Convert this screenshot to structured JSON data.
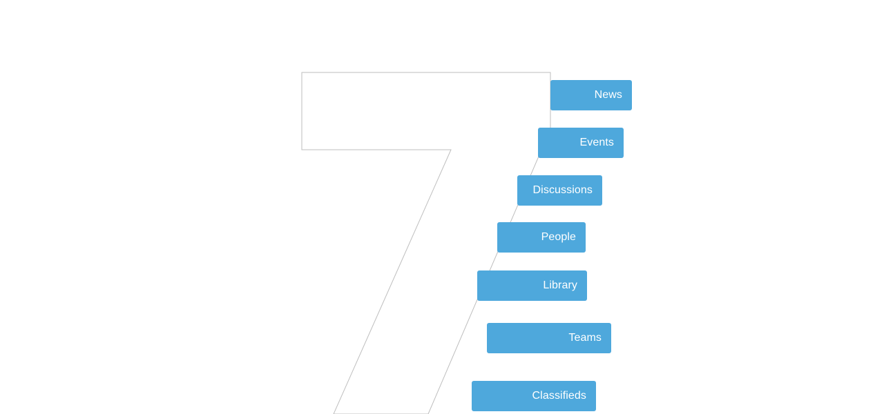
{
  "accent_color": "#4ea8dc",
  "outline_color": "#bdbdbd",
  "menu": {
    "items": [
      {
        "id": "news",
        "label": "News"
      },
      {
        "id": "events",
        "label": "Events"
      },
      {
        "id": "discussions",
        "label": "Discussions"
      },
      {
        "id": "people",
        "label": "People"
      },
      {
        "id": "library",
        "label": "Library"
      },
      {
        "id": "teams",
        "label": "Teams"
      },
      {
        "id": "classifieds",
        "label": "Classifieds"
      }
    ]
  }
}
